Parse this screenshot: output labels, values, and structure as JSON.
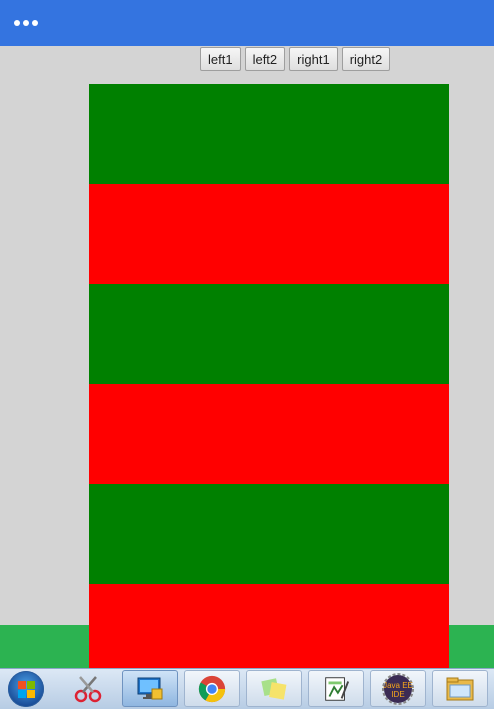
{
  "toolbar": {
    "buttons": [
      "left1",
      "left2",
      "right1",
      "right2"
    ]
  },
  "colors": {
    "titlebar": "#3474e0",
    "stripe_green": "#008000",
    "stripe_red": "#ff0000",
    "bottom_bar": "#2cb351"
  },
  "stripes": [
    "green",
    "red",
    "green",
    "red",
    "green",
    "red"
  ],
  "taskbar": {
    "icons": [
      "windows-start-icon",
      "snipping-tool-icon",
      "remote-desktop-icon",
      "chrome-icon",
      "sticky-notes-icon",
      "notepad-plus-plus-icon",
      "java-ee-ide-icon",
      "file-explorer-icon"
    ],
    "java_ide_label": "Java EE IDE"
  }
}
